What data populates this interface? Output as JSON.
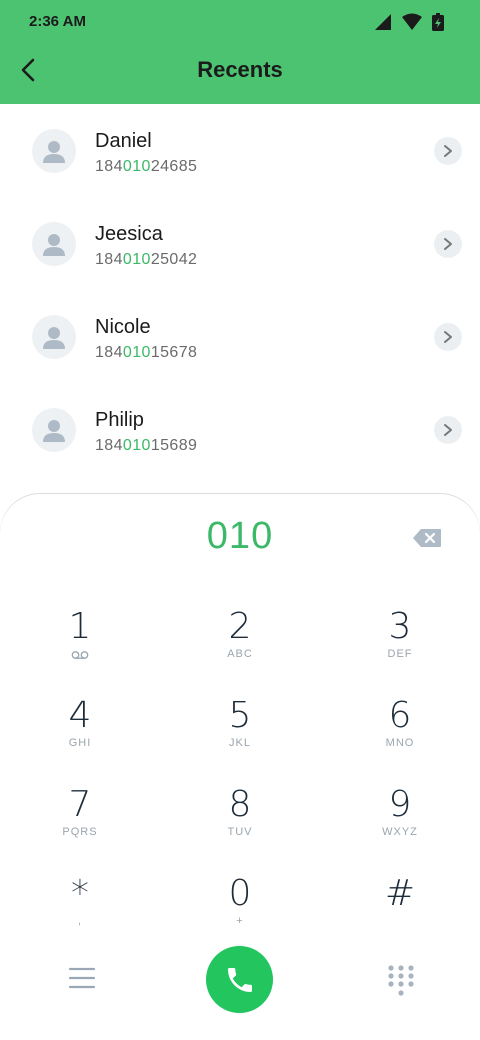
{
  "status_bar": {
    "time": "2:36 AM"
  },
  "header": {
    "title": "Recents"
  },
  "contacts": [
    {
      "name": "Daniel",
      "number_prefix": "184",
      "number_match": "010",
      "number_suffix": "24685"
    },
    {
      "name": "Jeesica",
      "number_prefix": "184",
      "number_match": "010",
      "number_suffix": "25042"
    },
    {
      "name": "Nicole",
      "number_prefix": "184",
      "number_match": "010",
      "number_suffix": "15678"
    },
    {
      "name": "Philip",
      "number_prefix": "184",
      "number_match": "010",
      "number_suffix": "15689"
    }
  ],
  "dialer": {
    "typed_number": "010",
    "keys": [
      {
        "digit": "1",
        "letters": ""
      },
      {
        "digit": "2",
        "letters": "ABC"
      },
      {
        "digit": "3",
        "letters": "DEF"
      },
      {
        "digit": "4",
        "letters": "GHI"
      },
      {
        "digit": "5",
        "letters": "JKL"
      },
      {
        "digit": "6",
        "letters": "MNO"
      },
      {
        "digit": "7",
        "letters": "PQRS"
      },
      {
        "digit": "8",
        "letters": "TUV"
      },
      {
        "digit": "9",
        "letters": "WXYZ"
      },
      {
        "digit": "*",
        "letters": ","
      },
      {
        "digit": "0",
        "letters": "+"
      },
      {
        "digit": "#",
        "letters": ""
      }
    ]
  },
  "icons": {
    "key1_sub": "voicemail-icon",
    "bottom_left": "menu-icon",
    "call": "phone-icon",
    "bottom_right": "dialpad-icon"
  },
  "colors": {
    "header_bg": "#4cc371",
    "accent": "#3bb868",
    "call_button": "#22c55e"
  }
}
